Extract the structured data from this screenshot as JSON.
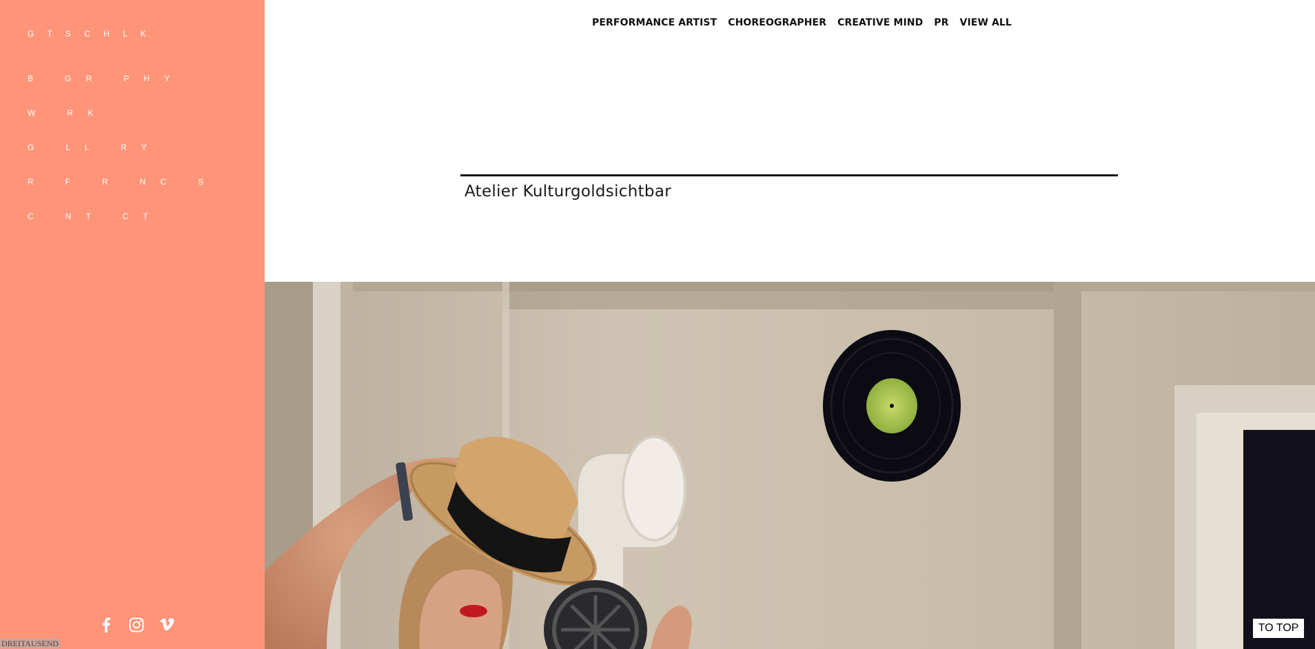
{
  "sidebar": {
    "brand": "G T S C H L K",
    "items": [
      {
        "label": "B   G R   P H Y"
      },
      {
        "label": "W   R K"
      },
      {
        "label": "G   L L   R Y"
      },
      {
        "label": "R   F   R   N C   S"
      },
      {
        "label": "C   N T   C T"
      }
    ],
    "social": [
      "facebook-icon",
      "instagram-icon",
      "vimeo-icon"
    ],
    "footer_label": "DREITAUSEND"
  },
  "top_nav": {
    "items": [
      {
        "label": "PERFORMANCE ARTIST"
      },
      {
        "label": "CHOREOGRAPHER"
      },
      {
        "label": "CREATIVE MIND"
      },
      {
        "label": "PR"
      },
      {
        "label": "VIEW ALL"
      }
    ]
  },
  "main": {
    "title": "Atelier Kulturgoldsichtbar"
  },
  "to_top": {
    "label": "TO TOP"
  },
  "colors": {
    "sidebar_bg": "#ff9478",
    "text_dark": "#111111",
    "white": "#ffffff"
  }
}
